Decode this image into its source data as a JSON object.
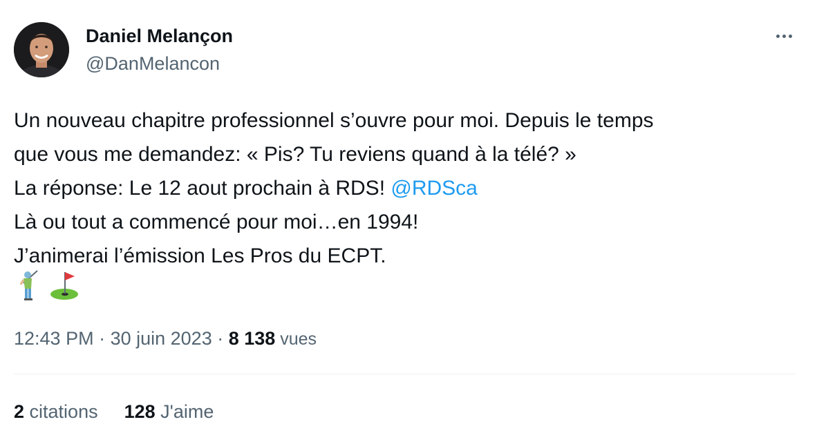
{
  "author": {
    "name": "Daniel Melançon",
    "handle": "@DanMelancon"
  },
  "tweet": {
    "line1": "Un nouveau chapitre professionnel s’ouvre pour moi. Depuis le temps",
    "line2": "que vous me demandez: « Pis? Tu reviens quand à la télé? »",
    "line3_text": "La réponse: Le 12 aout prochain à RDS! ",
    "line3_mention": "@RDSca",
    "line4": "Là ou tout a commencé pour moi…en 1994!",
    "line5": "J’animerai l’émission Les Pros du ECPT.",
    "emojis": [
      "golfer-emoji",
      "flag-in-hole-emoji"
    ]
  },
  "meta": {
    "time": "12:43 PM",
    "separator": " · ",
    "date": "30 juin 2023",
    "views_count": "8 138",
    "views_label": " vues"
  },
  "stats": {
    "quotes_count": "2",
    "quotes_label": " citations",
    "likes_count": "128",
    "likes_label": " J'aime"
  },
  "colors": {
    "text": "#0f1419",
    "secondary": "#536471",
    "link": "#1d9bf0",
    "divider": "#eff3f4"
  }
}
